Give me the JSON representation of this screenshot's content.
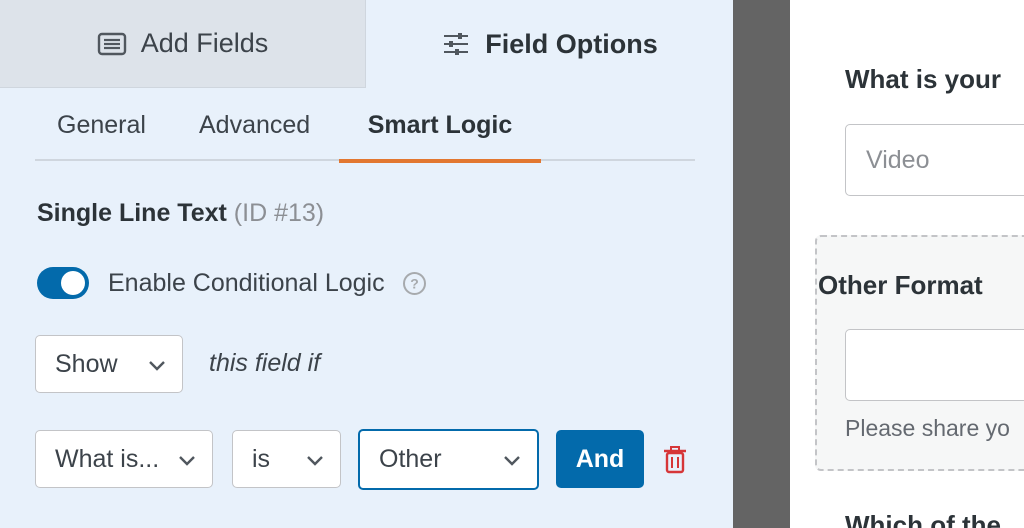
{
  "top_tabs": {
    "add_fields": {
      "label": "Add Fields",
      "icon": "list-icon"
    },
    "field_options": {
      "label": "Field Options",
      "icon": "sliders-icon"
    }
  },
  "sub_tabs": [
    {
      "label": "General"
    },
    {
      "label": "Advanced"
    },
    {
      "label": "Smart Logic",
      "active": true
    }
  ],
  "field": {
    "name": "Single Line Text",
    "id": "(ID #13)"
  },
  "conditional_logic": {
    "label": "Enable Conditional Logic",
    "enabled": true,
    "help_icon": "question-circle-icon"
  },
  "action": {
    "value": "Show",
    "suffix": "this field if"
  },
  "rule": {
    "field": "What is...",
    "operator": "is",
    "value": "Other",
    "and_label": "And",
    "delete_icon": "trash-icon"
  },
  "preview": {
    "q1_label": "What is your",
    "q1_value": "Video",
    "other_label": "Other Format",
    "other_desc": "Please share yo",
    "q3_label": "Which of the"
  },
  "colors": {
    "accent": "#036aab",
    "tab_underline": "#e27730",
    "panel_bg": "#e8f1fb",
    "divider": "#646464",
    "danger": "#d63638"
  }
}
